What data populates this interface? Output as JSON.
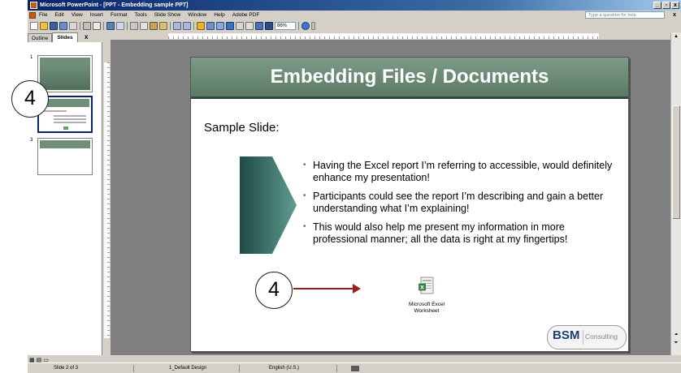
{
  "window": {
    "title": "Microsoft PowerPoint - [PPT - Embedding sample PPT]",
    "min_label": "_",
    "max_label": "▫",
    "close_label": "x"
  },
  "menu": {
    "items": [
      "File",
      "Edit",
      "View",
      "Insert",
      "Format",
      "Tools",
      "Slide Show",
      "Window",
      "Help",
      "Adobe PDF"
    ],
    "help_placeholder": "Type a question for help",
    "close_doc": "x"
  },
  "toolbar": {
    "zoom": "86%"
  },
  "pane": {
    "tab_outline": "Outline",
    "tab_slides": "Slides",
    "close": "x",
    "thumb_numbers": [
      "1",
      "2",
      "3"
    ]
  },
  "slide": {
    "title": "Embedding Files / Documents",
    "subtitle": "Sample Slide:",
    "bullets": [
      "Having the Excel report I’m referring to accessible, would definitely enhance my presentation!",
      "Participants could see the report I’m describing and gain a better understanding what I’m explaining!",
      "This would also help me present my information in more professional manner; all the data is right at my fingertips!"
    ],
    "embed_caption_line1": "Microsoft Excel",
    "embed_caption_line2": "Worksheet",
    "logo_main": "BSM",
    "logo_sub": "Consulting"
  },
  "callouts": {
    "left": "4",
    "bottom": "4"
  },
  "status": {
    "slide_of": "Slide 2 of 3",
    "design": "1_Default Design",
    "language": "English (U.S.)"
  },
  "colors": {
    "title_bar": "#0a246a",
    "slide_header": "#6f8f79",
    "arrow": "#9b1c1c",
    "logo_blue": "#1c3d6e"
  }
}
